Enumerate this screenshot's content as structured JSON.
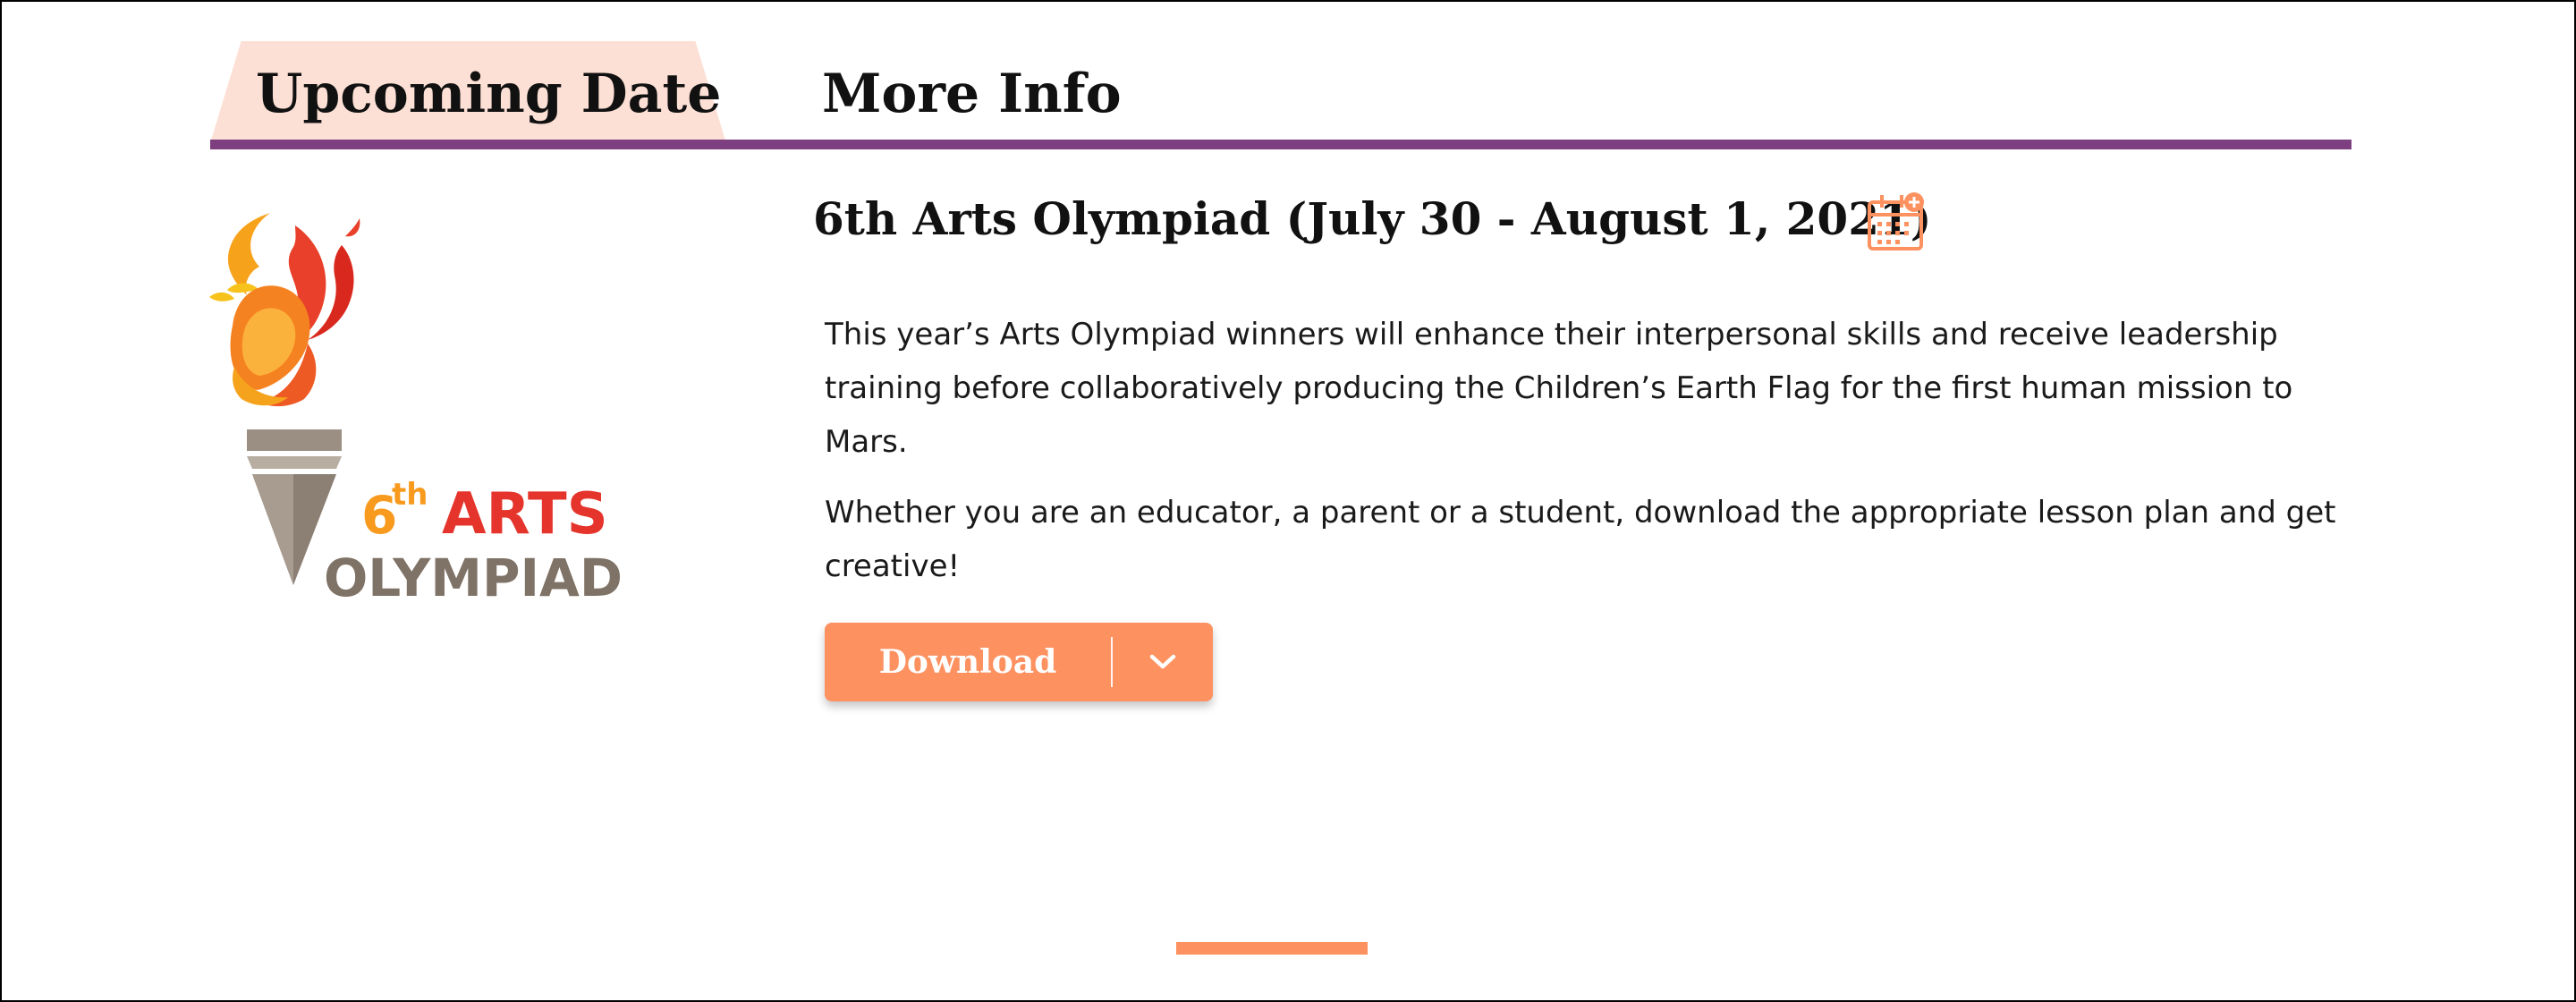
{
  "tabs": [
    {
      "label": "Upcoming Date",
      "active": true
    },
    {
      "label": "More Info",
      "active": false
    }
  ],
  "event": {
    "title": "6th Arts Olympiad (July 30 - August 1, 2021)",
    "description_1": "This year’s Arts Olympiad winners will enhance their interpersonal skills and receive leadership training before collaboratively producing the Children’s Earth Flag for the first human mission to Mars.",
    "description_2": "Whether you are an educator, a parent or a student, download the appropriate lesson plan and get creative!"
  },
  "logo": {
    "line1_number": "6",
    "line1_suffix": "th",
    "line1_word": "ARTS",
    "line2_word": "OLYMPIAD"
  },
  "download": {
    "label": "Download"
  },
  "icons": {
    "calendar": "calendar-add-icon",
    "caret": "chevron-down-icon",
    "torch": "torch-icon"
  },
  "colors": {
    "accent": "#fd9160",
    "tab_active_bg": "#fde0d5",
    "tab_underline": "#7d3f7f",
    "logo_red": "#e5342b",
    "logo_orange": "#f79a1d",
    "logo_gray": "#7f7266"
  }
}
